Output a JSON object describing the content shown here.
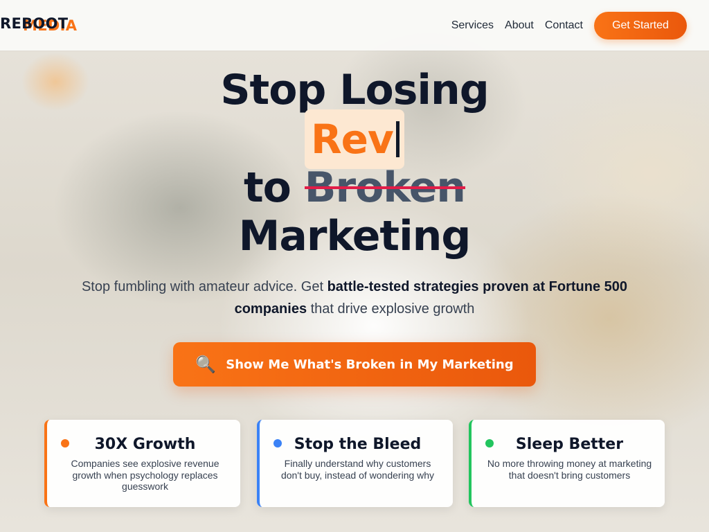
{
  "header": {
    "logo_part1": "REBOOT",
    "logo_part2": "MEDIA",
    "nav": [
      "Services",
      "About",
      "Contact"
    ],
    "cta": "Get Started"
  },
  "hero": {
    "line1": "Stop Losing",
    "typed_word": "Rev",
    "line3_prefix": "to",
    "line3_strike": "Broken",
    "line4": "Marketing",
    "sub_pre": "Stop fumbling with amateur advice. Get ",
    "sub_bold": "battle-tested strategies proven at Fortune 500 companies",
    "sub_post": " that drive explosive growth",
    "cta_icon": "magnifier-icon",
    "cta_label": "Show Me What's Broken in My Marketing"
  },
  "cards": [
    {
      "title": "30X Growth",
      "text": "Companies see explosive revenue growth when psychology replaces guesswork",
      "color": "#f97316"
    },
    {
      "title": "Stop the Bleed",
      "text": "Finally understand why customers don't buy, instead of wondering why",
      "color": "#3b82f6"
    },
    {
      "title": "Sleep Better",
      "text": "No more throwing money at marketing that doesn't bring customers",
      "color": "#22c55e"
    }
  ],
  "colors": {
    "accent": "#f97316",
    "dark": "#0f172a",
    "strike": "#e11d48"
  }
}
